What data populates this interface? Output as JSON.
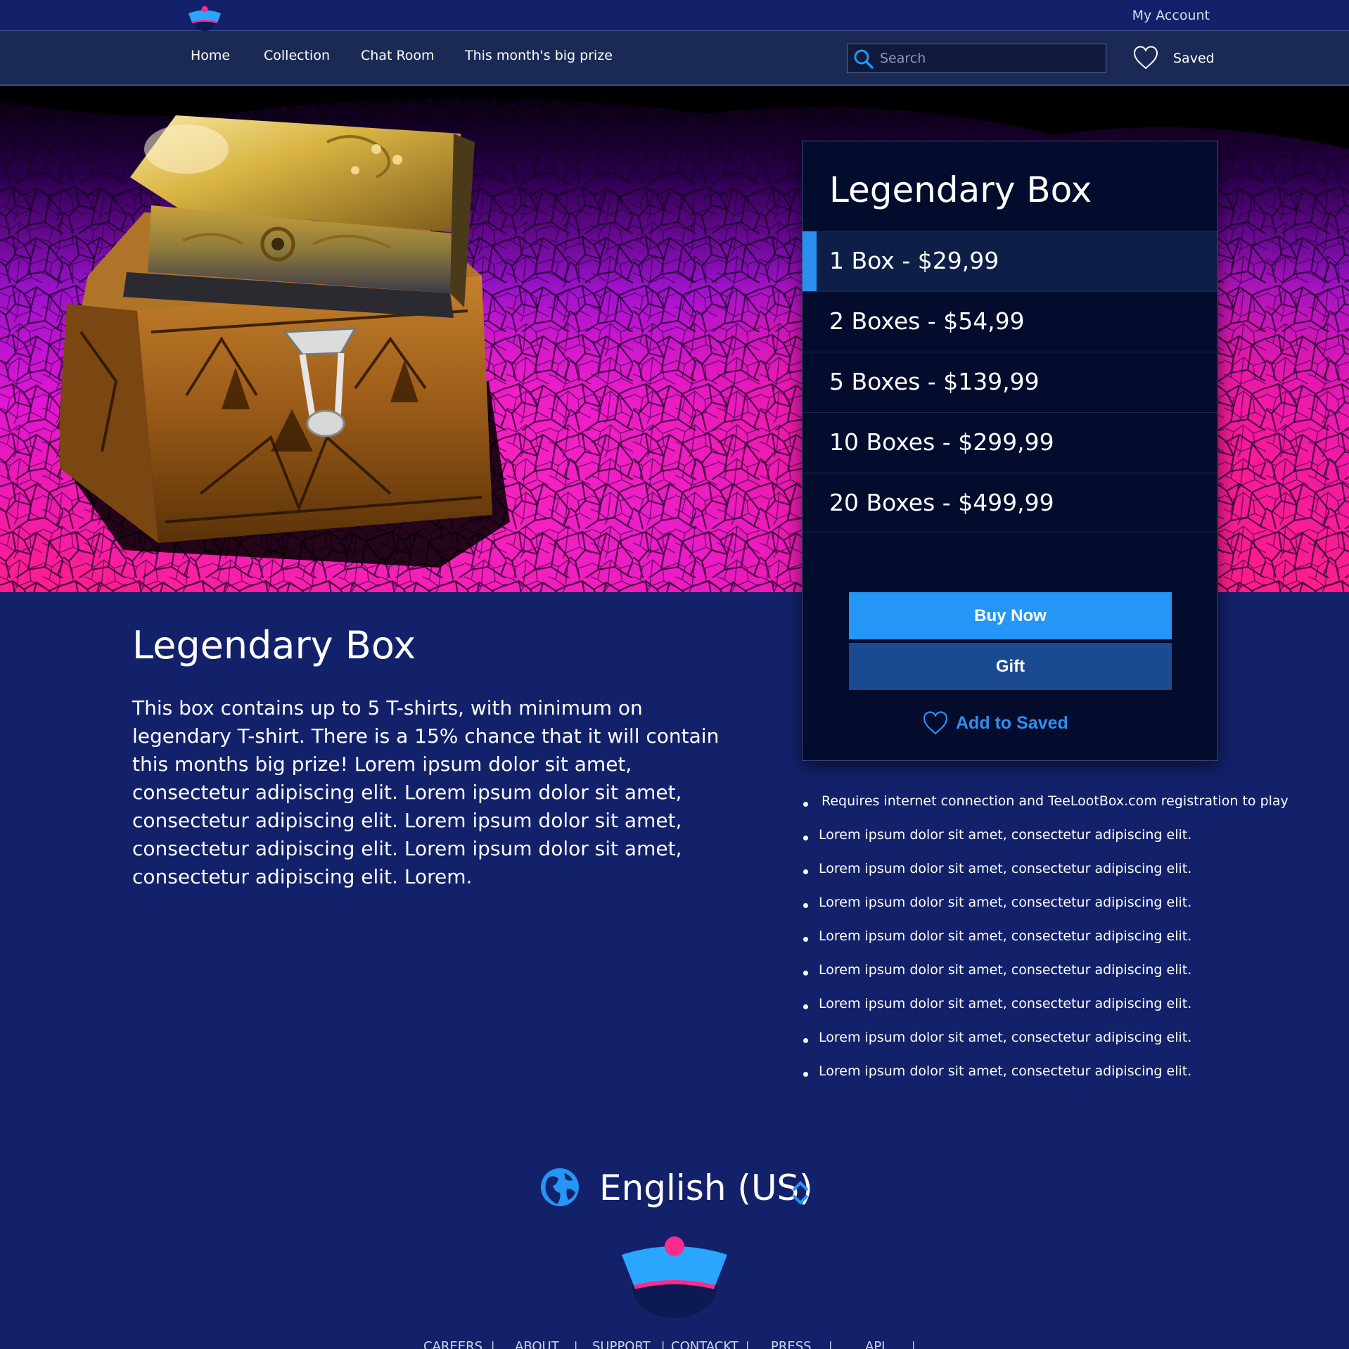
{
  "header": {
    "my_account": "My Account"
  },
  "nav": {
    "items": [
      {
        "label": "Home"
      },
      {
        "label": "Collection"
      },
      {
        "label": "Chat Room"
      },
      {
        "label": "This month's big prize"
      }
    ],
    "search_placeholder": "Search",
    "saved_label": "Saved"
  },
  "purchase": {
    "title": "Legendary Box",
    "options": [
      {
        "label": "1 Box - $29,99",
        "selected": true
      },
      {
        "label": "2 Boxes - $54,99",
        "selected": false
      },
      {
        "label": "5 Boxes - $139,99",
        "selected": false
      },
      {
        "label": "10 Boxes - $299,99",
        "selected": false
      },
      {
        "label": "20 Boxes - $499,99",
        "selected": false
      }
    ],
    "buy_now": "Buy Now",
    "gift": "Gift",
    "add_to_saved": "Add to Saved"
  },
  "product": {
    "title": "Legendary Box",
    "description": "This box contains up to 5 T-shirts, with minimum on legendary T-shirt. There is a 15% chance that it will contain this months big prize! Lorem ipsum dolor sit amet, consectetur adipiscing elit. Lorem ipsum dolor sit amet, consectetur adipiscing elit. Lorem ipsum dolor sit amet, consectetur adipiscing elit. Lorem ipsum dolor sit amet, consectetur adipiscing elit. Lorem."
  },
  "features": [
    "Requires internet connection and TeeLootBox.com registration to play",
    "Lorem ipsum dolor sit amet, consectetur adipiscing elit.",
    "Lorem ipsum dolor sit amet, consectetur adipiscing elit.",
    "Lorem ipsum dolor sit amet, consectetur adipiscing elit.",
    "Lorem ipsum dolor sit amet, consectetur adipiscing elit.",
    "Lorem ipsum dolor sit amet, consectetur adipiscing elit.",
    "Lorem ipsum dolor sit amet, consectetur adipiscing elit.",
    "Lorem ipsum dolor sit amet, consectetur adipiscing elit.",
    "Lorem ipsum dolor sit amet, consectetur adipiscing elit."
  ],
  "footer": {
    "language": "English (US)",
    "links": [
      "CAREERS",
      "ABOUT",
      "SUPPORT",
      "CONTACKT",
      "PRESS",
      "API"
    ]
  },
  "icons": {
    "logo": "logo-hat-icon",
    "search": "search-icon",
    "heart": "heart-icon",
    "globe": "globe-icon",
    "language_toggle": "chevron-updown-icon"
  },
  "colors": {
    "page_background": "#13216a",
    "navbar": "#1b2a54",
    "panel": "#030c2d",
    "accent": "#2496f5",
    "gift_button": "#1a4a90",
    "logo_pink": "#ff2a8a"
  }
}
